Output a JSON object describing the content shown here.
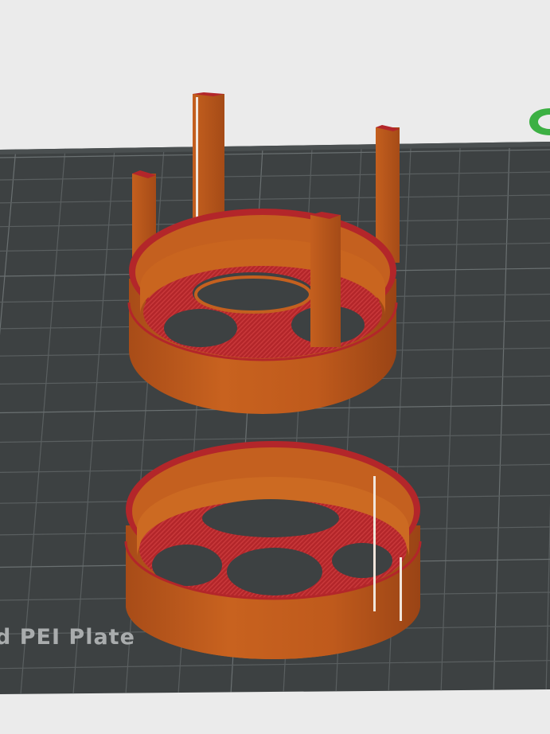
{
  "app": {
    "plate_label": "d PEI Plate",
    "logo_glyph": "ɑ"
  },
  "colors": {
    "background": "#ebebeb",
    "bed": "#3d4142",
    "grid": "#5a5f60",
    "grid_major": "#6a7071",
    "filament": "#b8571f",
    "filament_dark": "#9c4716",
    "infill": "#b3262a",
    "logo": "#3cb043"
  },
  "icons": {
    "logo": "bambu-logo-icon"
  }
}
